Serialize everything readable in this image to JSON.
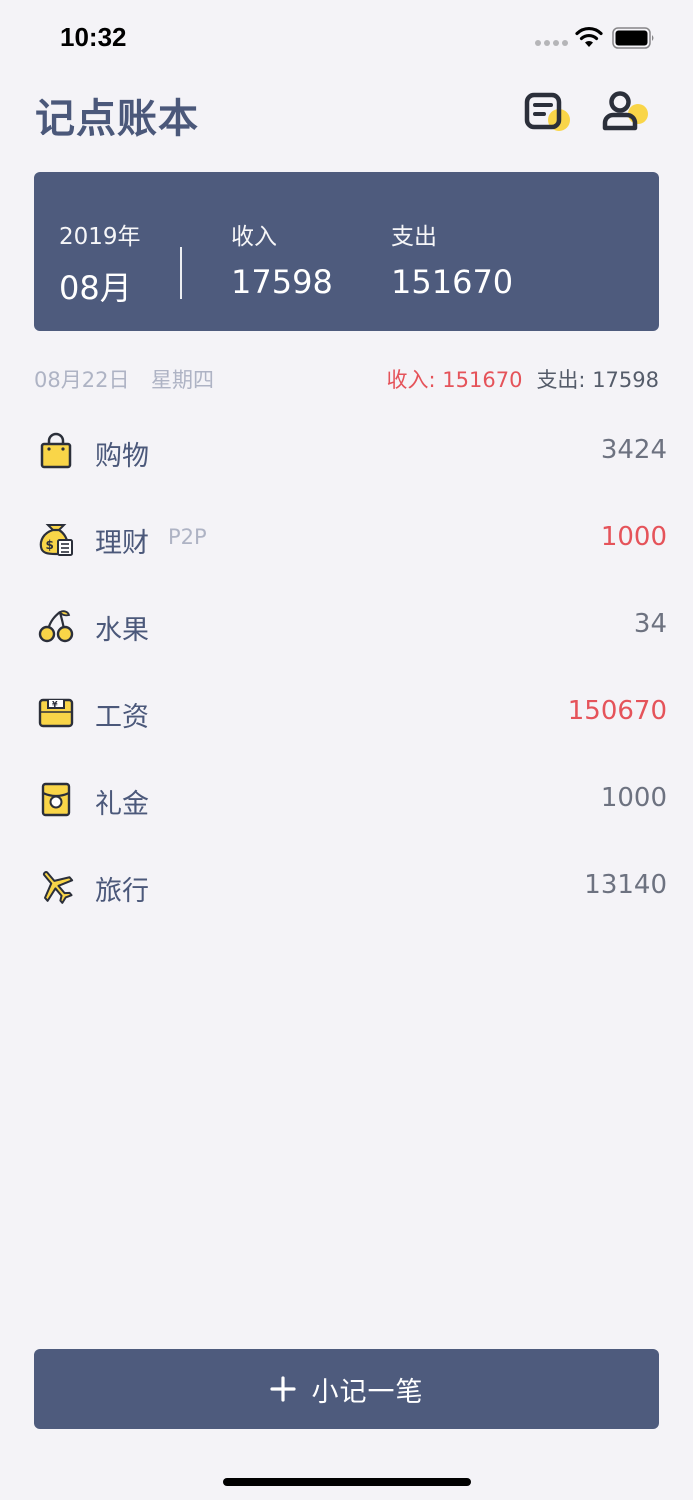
{
  "status_bar": {
    "time": "10:32"
  },
  "header": {
    "title": "记点账本"
  },
  "summary": {
    "year": "2019年",
    "month": "08月",
    "income_label": "收入",
    "income_value": "17598",
    "expense_label": "支出",
    "expense_value": "151670"
  },
  "day": {
    "date": "08月22日",
    "weekday": "星期四",
    "income_text": "收入: 151670",
    "expense_text": "支出: 17598"
  },
  "records": [
    {
      "name": "购物",
      "note": "",
      "amount": "3424",
      "type": "expense",
      "icon": "shopping-bag-icon"
    },
    {
      "name": "理财",
      "note": "P2P",
      "amount": "1000",
      "type": "income",
      "icon": "money-bag-icon"
    },
    {
      "name": "水果",
      "note": "",
      "amount": "34",
      "type": "expense",
      "icon": "cherry-icon"
    },
    {
      "name": "工资",
      "note": "",
      "amount": "150670",
      "type": "income",
      "icon": "salary-envelope-icon"
    },
    {
      "name": "礼金",
      "note": "",
      "amount": "1000",
      "type": "expense",
      "icon": "gift-money-icon"
    },
    {
      "name": "旅行",
      "note": "",
      "amount": "13140",
      "type": "expense",
      "icon": "airplane-icon"
    }
  ],
  "add_button": {
    "label": "小记一笔"
  },
  "colors": {
    "primary": "#4e5b7d",
    "accent_yellow": "#f9d548",
    "income_red": "#e5535a",
    "background": "#f4f3f7"
  }
}
